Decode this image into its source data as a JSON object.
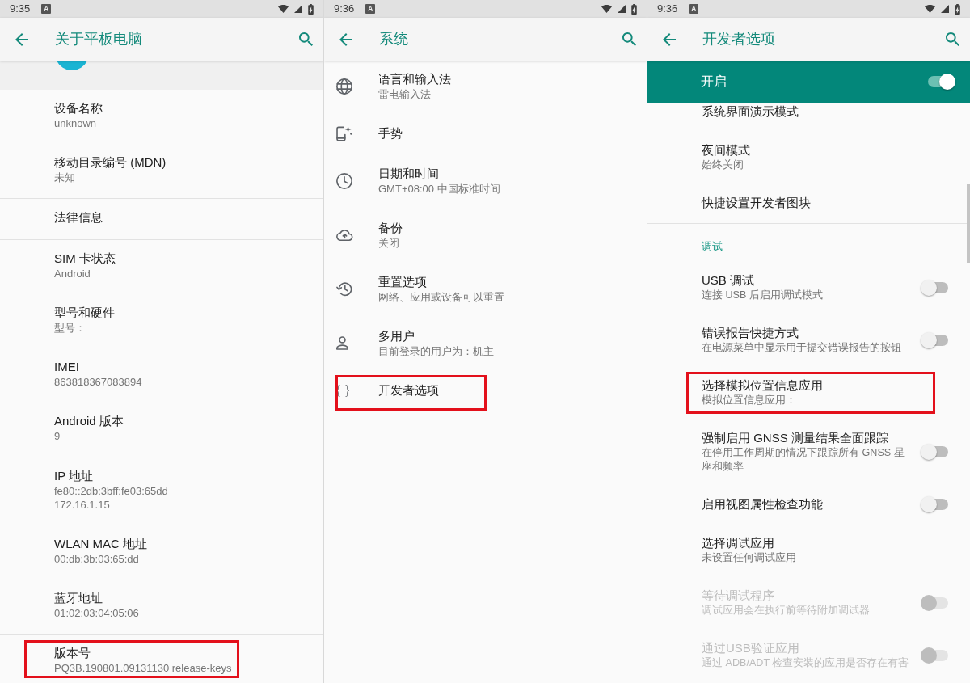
{
  "screens": [
    {
      "status_bar": {
        "time": "9:35",
        "notification": "A"
      },
      "app_bar": {
        "title": "关于平板电脑"
      },
      "sections": [
        {
          "kind": "avatar"
        },
        {
          "kind": "list",
          "items": [
            {
              "title": "设备名称",
              "summary": "unknown",
              "highlighted": false
            },
            {
              "title": "移动目录编号 (MDN)",
              "summary": "未知",
              "highlighted": false
            }
          ]
        },
        {
          "kind": "list",
          "items": [
            {
              "title": "法律信息",
              "highlighted": false
            }
          ]
        },
        {
          "kind": "list",
          "items": [
            {
              "title": "SIM 卡状态",
              "summary": "Android",
              "highlighted": false
            },
            {
              "title": "型号和硬件",
              "summary": "型号：",
              "highlighted": false
            },
            {
              "title": "IMEI",
              "summary": "863818367083894",
              "highlighted": false
            },
            {
              "title": "Android 版本",
              "summary": "9",
              "highlighted": false
            }
          ]
        },
        {
          "kind": "list",
          "items": [
            {
              "title": "IP 地址",
              "summary": "fe80::2db:3bff:fe03:65dd\n172.16.1.15",
              "highlighted": false
            },
            {
              "title": "WLAN MAC 地址",
              "summary": "00:db:3b:03:65:dd",
              "highlighted": false
            },
            {
              "title": "蓝牙地址",
              "summary": "01:02:03:04:05:06",
              "highlighted": false
            }
          ]
        },
        {
          "kind": "list",
          "items": [
            {
              "title": "版本号",
              "summary": "PQ3B.190801.09131130 release-keys",
              "highlighted": true
            }
          ]
        }
      ]
    },
    {
      "status_bar": {
        "time": "9:36",
        "notification": "A"
      },
      "app_bar": {
        "title": "系统"
      },
      "sections": [
        {
          "kind": "list",
          "items": [
            {
              "kind": "language",
              "title": "语言和输入法",
              "summary": "雷电输入法",
              "highlighted": false
            },
            {
              "kind": "gestures",
              "title": "手势",
              "highlighted": false
            },
            {
              "kind": "datetime",
              "title": "日期和时间",
              "summary": "GMT+08:00 中国标准时间",
              "highlighted": false
            },
            {
              "kind": "backup",
              "title": "备份",
              "summary": "关闭",
              "highlighted": false
            },
            {
              "kind": "reset",
              "title": "重置选项",
              "summary": "网络、应用或设备可以重置",
              "highlighted": false
            },
            {
              "kind": "users",
              "title": "多用户",
              "summary": "目前登录的用户为：机主",
              "highlighted": false
            },
            {
              "kind": "developer",
              "title": "开发者选项",
              "highlighted": true
            }
          ]
        }
      ]
    },
    {
      "status_bar": {
        "time": "9:36",
        "notification": "A"
      },
      "app_bar": {
        "title": "开发者选项"
      },
      "master_switch": {
        "label": "开启",
        "on": true
      },
      "scrollbar": true,
      "sections": [
        {
          "kind": "list",
          "items": [
            {
              "kind": "plain",
              "title": "系统界面演示模式",
              "disabled": false,
              "highlighted": false
            },
            {
              "kind": "plain",
              "title": "夜间模式",
              "summary": "始终关闭",
              "disabled": false,
              "highlighted": false
            },
            {
              "kind": "plain",
              "title": "快捷设置开发者图块",
              "disabled": false,
              "highlighted": false
            }
          ]
        },
        {
          "kind": "list",
          "header": "调试",
          "items": [
            {
              "kind": "switch",
              "title": "USB 调试",
              "summary": "连接 USB 后启用调试模式",
              "on": false,
              "disabled": false,
              "highlighted": false
            },
            {
              "kind": "switch",
              "title": "错误报告快捷方式",
              "summary": "在电源菜单中显示用于提交错误报告的按钮",
              "on": false,
              "disabled": false,
              "highlighted": false
            },
            {
              "kind": "plain",
              "title": "选择模拟位置信息应用",
              "summary": "模拟位置信息应用：",
              "disabled": false,
              "highlighted": true
            },
            {
              "kind": "switch",
              "title": "强制启用 GNSS 测量结果全面跟踪",
              "summary": "在停用工作周期的情况下跟踪所有 GNSS 星座和频率",
              "on": false,
              "disabled": false,
              "highlighted": false
            },
            {
              "kind": "switch",
              "title": "启用视图属性检查功能",
              "on": false,
              "disabled": false,
              "highlighted": false
            },
            {
              "kind": "plain",
              "title": "选择调试应用",
              "summary": "未设置任何调试应用",
              "disabled": false,
              "highlighted": false
            },
            {
              "kind": "switch",
              "title": "等待调试程序",
              "summary": "调试应用会在执行前等待附加调试器",
              "on": false,
              "disabled": true,
              "highlighted": false
            },
            {
              "kind": "switch",
              "title": "通过USB验证应用",
              "summary": "通过 ADB/ADT 检查安装的应用是否存在有害",
              "on": false,
              "disabled": true,
              "highlighted": false
            }
          ]
        }
      ]
    }
  ]
}
